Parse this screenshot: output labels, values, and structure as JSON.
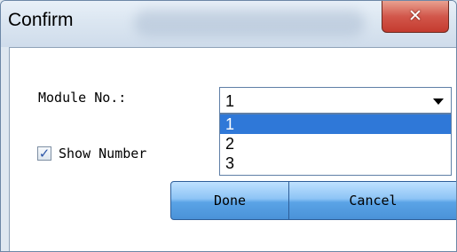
{
  "window": {
    "title": "Confirm",
    "close_icon": "✕"
  },
  "form": {
    "module_label": "Module No.:",
    "module_selected": "1",
    "module_options": [
      "1",
      "2",
      "3"
    ],
    "show_number_label": "Show Number",
    "show_number_checked": true,
    "check_mark": "✓"
  },
  "buttons": {
    "done": "Done",
    "cancel": "Cancel"
  }
}
